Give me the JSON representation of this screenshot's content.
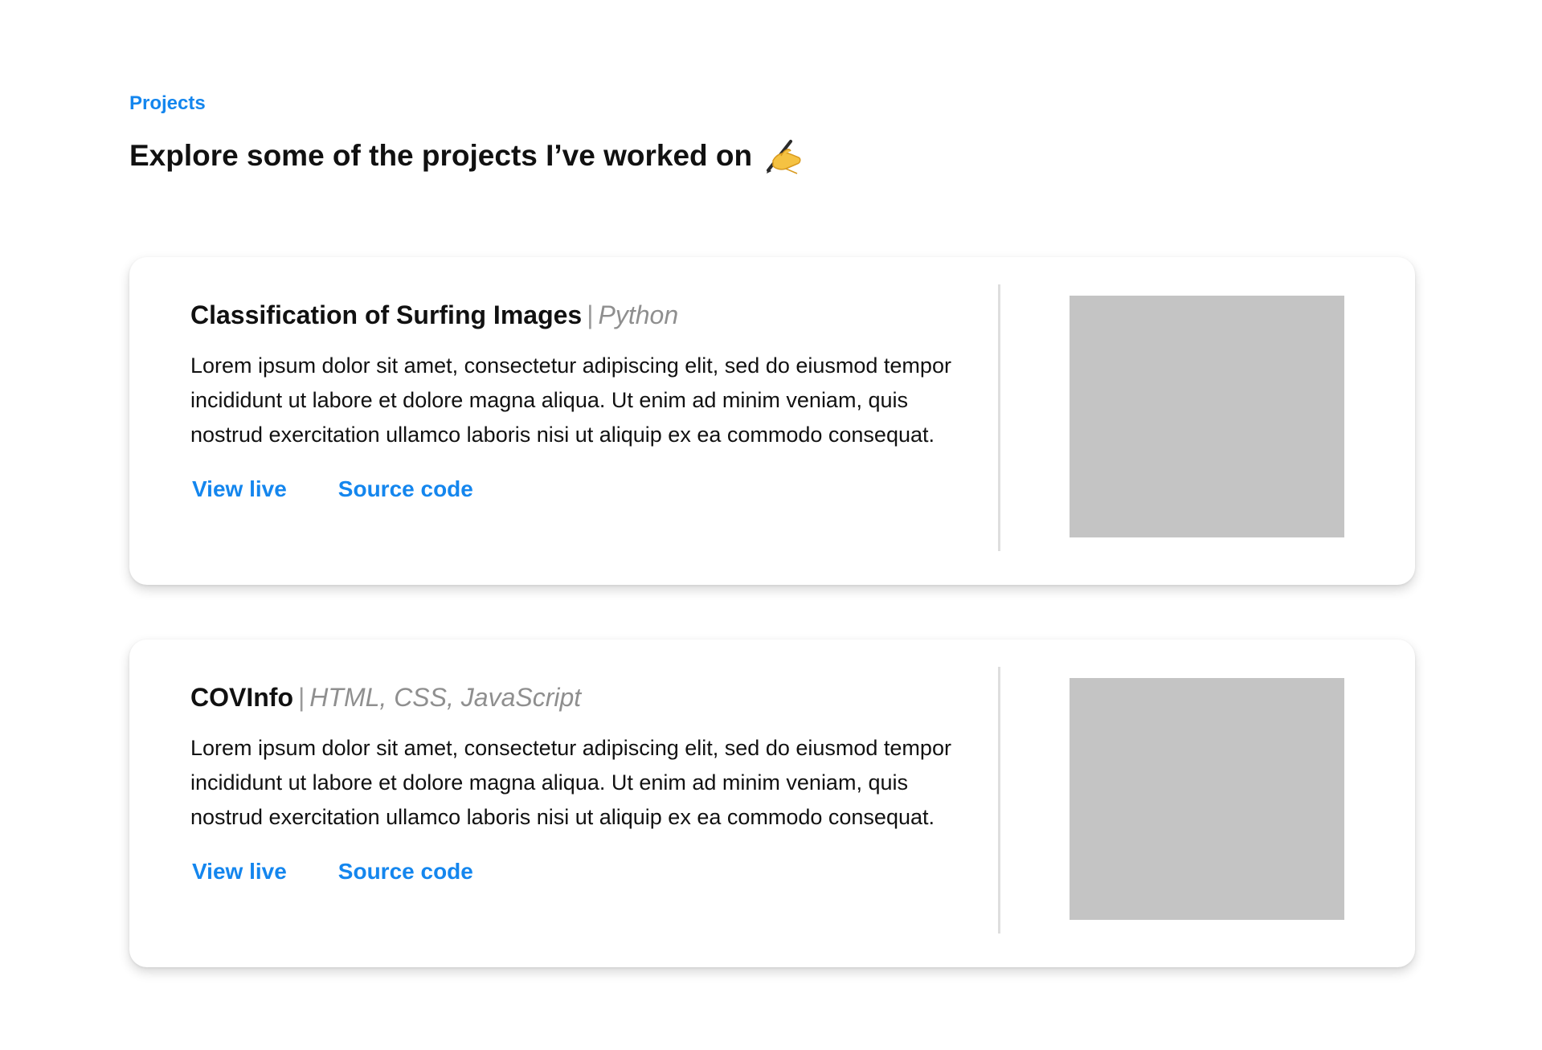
{
  "section": {
    "label": "Projects",
    "heading": "Explore some of the projects I’ve worked on",
    "heading_icon": "writing-hand-icon"
  },
  "projects": [
    {
      "title": "Classification of Surfing Images",
      "separator": "|",
      "tech": "Python",
      "description": "Lorem ipsum dolor sit amet, consectetur adipiscing elit, sed do eiusmod tempor incididunt ut labore et dolore magna aliqua. Ut enim ad minim veniam, quis nostrud exercitation ullamco laboris nisi ut aliquip ex ea commodo consequat.",
      "view_live_label": "View live",
      "source_code_label": "Source code"
    },
    {
      "title": "COVInfo",
      "separator": "|",
      "tech": "HTML, CSS, JavaScript",
      "description": "Lorem ipsum dolor sit amet, consectetur adipiscing elit, sed do eiusmod tempor incididunt ut labore et dolore magna aliqua. Ut enim ad minim veniam, quis nostrud exercitation ullamco laboris nisi ut aliquip ex ea commodo consequat.",
      "view_live_label": "View live",
      "source_code_label": "Source code"
    }
  ],
  "colors": {
    "accent": "#1486ee",
    "text": "#111111",
    "muted": "#8f8f8f",
    "placeholder": "#c4c4c4",
    "divider": "#dedede"
  }
}
